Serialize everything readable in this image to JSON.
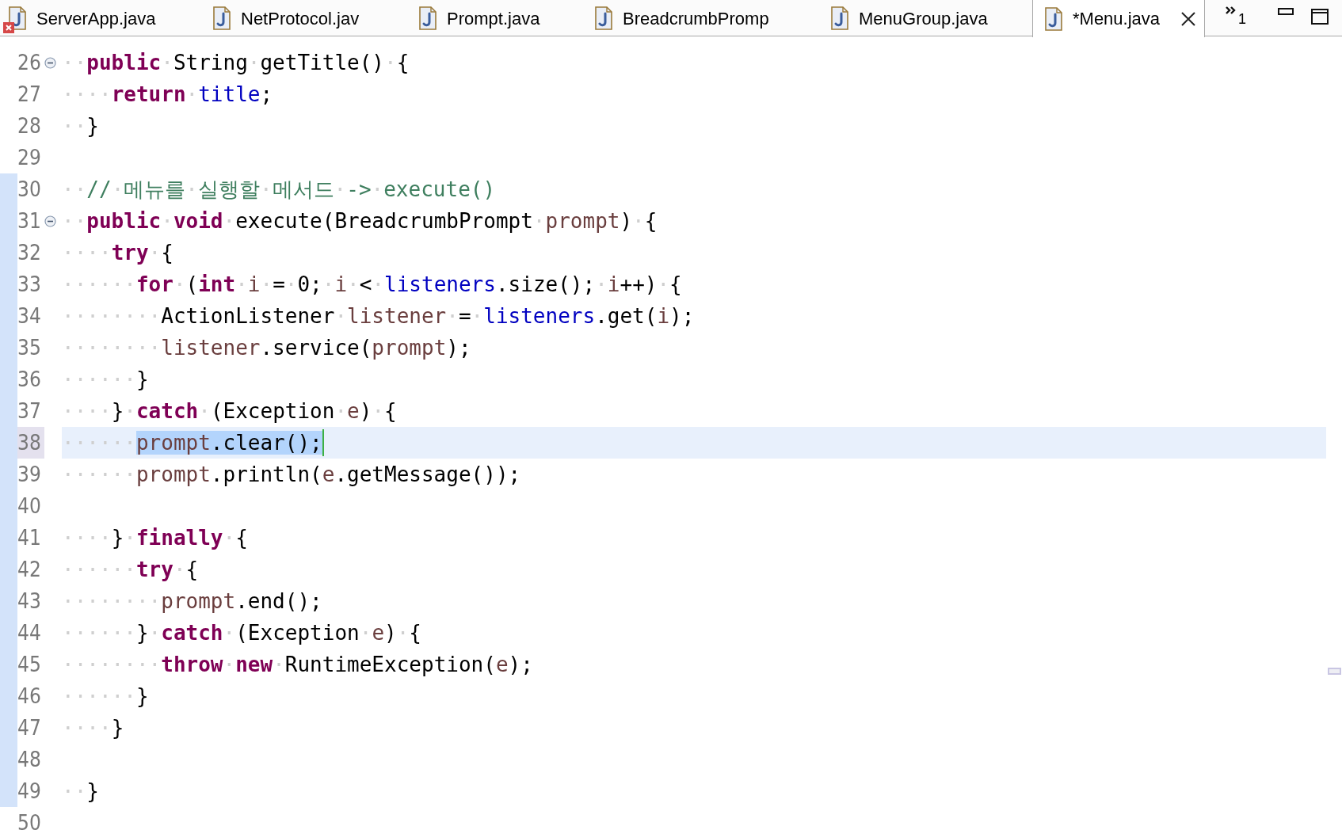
{
  "tabs": [
    {
      "label": "ServerApp.java",
      "selected": false,
      "has_error": true
    },
    {
      "label": "NetProtocol.jav",
      "selected": false,
      "has_error": false
    },
    {
      "label": "Prompt.java",
      "selected": false,
      "has_error": false
    },
    {
      "label": "BreadcrumbPromp",
      "selected": false,
      "has_error": false
    },
    {
      "label": "MenuGroup.java",
      "selected": false,
      "has_error": false
    },
    {
      "label": "*Menu.java",
      "selected": true,
      "has_error": false
    }
  ],
  "tab_overflow_count": "1",
  "lines": [
    {
      "number": "26",
      "fold": true,
      "current": false,
      "changed": false,
      "tokens": [
        {
          "kind": "ws",
          "text": "··"
        },
        {
          "kind": "kw",
          "text": "public"
        },
        {
          "kind": "ws",
          "text": "·"
        },
        {
          "kind": "plain",
          "text": "String"
        },
        {
          "kind": "ws",
          "text": "·"
        },
        {
          "kind": "plain",
          "text": "getTitle()"
        },
        {
          "kind": "ws",
          "text": "·"
        },
        {
          "kind": "plain",
          "text": "{"
        }
      ]
    },
    {
      "number": "27",
      "fold": false,
      "current": false,
      "changed": false,
      "tokens": [
        {
          "kind": "ws",
          "text": "····"
        },
        {
          "kind": "kw",
          "text": "return"
        },
        {
          "kind": "ws",
          "text": "·"
        },
        {
          "kind": "field",
          "text": "title"
        },
        {
          "kind": "plain",
          "text": ";"
        }
      ]
    },
    {
      "number": "28",
      "fold": false,
      "current": false,
      "changed": false,
      "tokens": [
        {
          "kind": "ws",
          "text": "··"
        },
        {
          "kind": "plain",
          "text": "}"
        }
      ]
    },
    {
      "number": "29",
      "fold": false,
      "current": false,
      "changed": false
    },
    {
      "number": "30",
      "fold": false,
      "current": false,
      "changed": true,
      "tokens": [
        {
          "kind": "ws",
          "text": "··"
        },
        {
          "kind": "comment",
          "text": "//"
        },
        {
          "kind": "ws",
          "text": "·"
        },
        {
          "kind": "comment",
          "text": "메뉴를"
        },
        {
          "kind": "ws",
          "text": "·"
        },
        {
          "kind": "comment",
          "text": "실행할"
        },
        {
          "kind": "ws",
          "text": "·"
        },
        {
          "kind": "comment",
          "text": "메서드"
        },
        {
          "kind": "ws",
          "text": "·"
        },
        {
          "kind": "comment",
          "text": "->"
        },
        {
          "kind": "ws",
          "text": "·"
        },
        {
          "kind": "comment",
          "text": "execute()"
        }
      ]
    },
    {
      "number": "31",
      "fold": true,
      "current": false,
      "changed": true,
      "tokens": [
        {
          "kind": "ws",
          "text": "··"
        },
        {
          "kind": "kw",
          "text": "public"
        },
        {
          "kind": "ws",
          "text": "·"
        },
        {
          "kind": "kw",
          "text": "void"
        },
        {
          "kind": "ws",
          "text": "·"
        },
        {
          "kind": "plain",
          "text": "execute(BreadcrumbPrompt"
        },
        {
          "kind": "ws",
          "text": "·"
        },
        {
          "kind": "local",
          "text": "prompt"
        },
        {
          "kind": "plain",
          "text": ")"
        },
        {
          "kind": "ws",
          "text": "·"
        },
        {
          "kind": "plain",
          "text": "{"
        }
      ]
    },
    {
      "number": "32",
      "fold": false,
      "current": false,
      "changed": true,
      "tokens": [
        {
          "kind": "ws",
          "text": "····"
        },
        {
          "kind": "kw",
          "text": "try"
        },
        {
          "kind": "ws",
          "text": "·"
        },
        {
          "kind": "plain",
          "text": "{"
        }
      ]
    },
    {
      "number": "33",
      "fold": false,
      "current": false,
      "changed": true,
      "tokens": [
        {
          "kind": "ws",
          "text": "······"
        },
        {
          "kind": "kw",
          "text": "for"
        },
        {
          "kind": "ws",
          "text": "·"
        },
        {
          "kind": "plain",
          "text": "("
        },
        {
          "kind": "kw",
          "text": "int"
        },
        {
          "kind": "ws",
          "text": "·"
        },
        {
          "kind": "local",
          "text": "i"
        },
        {
          "kind": "ws",
          "text": "·"
        },
        {
          "kind": "plain",
          "text": "="
        },
        {
          "kind": "ws",
          "text": "·"
        },
        {
          "kind": "plain",
          "text": "0;"
        },
        {
          "kind": "ws",
          "text": "·"
        },
        {
          "kind": "local",
          "text": "i"
        },
        {
          "kind": "ws",
          "text": "·"
        },
        {
          "kind": "plain",
          "text": "<"
        },
        {
          "kind": "ws",
          "text": "·"
        },
        {
          "kind": "field",
          "text": "listeners"
        },
        {
          "kind": "plain",
          "text": ".size();"
        },
        {
          "kind": "ws",
          "text": "·"
        },
        {
          "kind": "local",
          "text": "i"
        },
        {
          "kind": "plain",
          "text": "++)"
        },
        {
          "kind": "ws",
          "text": "·"
        },
        {
          "kind": "plain",
          "text": "{"
        }
      ]
    },
    {
      "number": "34",
      "fold": false,
      "current": false,
      "changed": true,
      "tokens": [
        {
          "kind": "ws",
          "text": "········"
        },
        {
          "kind": "plain",
          "text": "ActionListener"
        },
        {
          "kind": "ws",
          "text": "·"
        },
        {
          "kind": "local",
          "text": "listener"
        },
        {
          "kind": "ws",
          "text": "·"
        },
        {
          "kind": "plain",
          "text": "="
        },
        {
          "kind": "ws",
          "text": "·"
        },
        {
          "kind": "field",
          "text": "listeners"
        },
        {
          "kind": "plain",
          "text": ".get("
        },
        {
          "kind": "local",
          "text": "i"
        },
        {
          "kind": "plain",
          "text": ");"
        }
      ]
    },
    {
      "number": "35",
      "fold": false,
      "current": false,
      "changed": true,
      "tokens": [
        {
          "kind": "ws",
          "text": "········"
        },
        {
          "kind": "local",
          "text": "listener"
        },
        {
          "kind": "plain",
          "text": ".service("
        },
        {
          "kind": "local",
          "text": "prompt"
        },
        {
          "kind": "plain",
          "text": ");"
        }
      ]
    },
    {
      "number": "36",
      "fold": false,
      "current": false,
      "changed": true,
      "tokens": [
        {
          "kind": "ws",
          "text": "······"
        },
        {
          "kind": "plain",
          "text": "}"
        }
      ]
    },
    {
      "number": "37",
      "fold": false,
      "current": false,
      "changed": true,
      "tokens": [
        {
          "kind": "ws",
          "text": "····"
        },
        {
          "kind": "plain",
          "text": "}"
        },
        {
          "kind": "ws",
          "text": "·"
        },
        {
          "kind": "kw",
          "text": "catch"
        },
        {
          "kind": "ws",
          "text": "·"
        },
        {
          "kind": "plain",
          "text": "(Exception"
        },
        {
          "kind": "ws",
          "text": "·"
        },
        {
          "kind": "local",
          "text": "e"
        },
        {
          "kind": "plain",
          "text": ")"
        },
        {
          "kind": "ws",
          "text": "·"
        },
        {
          "kind": "plain",
          "text": "{"
        }
      ]
    },
    {
      "number": "38",
      "fold": false,
      "current": true,
      "changed": true,
      "tokens": [
        {
          "kind": "ws",
          "text": "······"
        },
        {
          "kind": "selection",
          "tokens": [
            {
              "kind": "local",
              "text": "prompt"
            },
            {
              "kind": "plain",
              "text": ".clear();"
            }
          ]
        }
      ]
    },
    {
      "number": "39",
      "fold": false,
      "current": false,
      "changed": true,
      "tokens": [
        {
          "kind": "ws",
          "text": "······"
        },
        {
          "kind": "local",
          "text": "prompt"
        },
        {
          "kind": "plain",
          "text": ".println("
        },
        {
          "kind": "local",
          "text": "e"
        },
        {
          "kind": "plain",
          "text": ".getMessage());"
        }
      ]
    },
    {
      "number": "40",
      "fold": false,
      "current": false,
      "changed": true
    },
    {
      "number": "41",
      "fold": false,
      "current": false,
      "changed": true,
      "tokens": [
        {
          "kind": "ws",
          "text": "····"
        },
        {
          "kind": "plain",
          "text": "}"
        },
        {
          "kind": "ws",
          "text": "·"
        },
        {
          "kind": "kw",
          "text": "finally"
        },
        {
          "kind": "ws",
          "text": "·"
        },
        {
          "kind": "plain",
          "text": "{"
        }
      ]
    },
    {
      "number": "42",
      "fold": false,
      "current": false,
      "changed": true,
      "tokens": [
        {
          "kind": "ws",
          "text": "······"
        },
        {
          "kind": "kw",
          "text": "try"
        },
        {
          "kind": "ws",
          "text": "·"
        },
        {
          "kind": "plain",
          "text": "{"
        }
      ]
    },
    {
      "number": "43",
      "fold": false,
      "current": false,
      "changed": true,
      "tokens": [
        {
          "kind": "ws",
          "text": "········"
        },
        {
          "kind": "local",
          "text": "prompt"
        },
        {
          "kind": "plain",
          "text": ".end();"
        }
      ]
    },
    {
      "number": "44",
      "fold": false,
      "current": false,
      "changed": true,
      "tokens": [
        {
          "kind": "ws",
          "text": "······"
        },
        {
          "kind": "plain",
          "text": "}"
        },
        {
          "kind": "ws",
          "text": "·"
        },
        {
          "kind": "kw",
          "text": "catch"
        },
        {
          "kind": "ws",
          "text": "·"
        },
        {
          "kind": "plain",
          "text": "(Exception"
        },
        {
          "kind": "ws",
          "text": "·"
        },
        {
          "kind": "local",
          "text": "e"
        },
        {
          "kind": "plain",
          "text": ")"
        },
        {
          "kind": "ws",
          "text": "·"
        },
        {
          "kind": "plain",
          "text": "{"
        }
      ]
    },
    {
      "number": "45",
      "fold": false,
      "current": false,
      "changed": true,
      "tokens": [
        {
          "kind": "ws",
          "text": "········"
        },
        {
          "kind": "kw",
          "text": "throw"
        },
        {
          "kind": "ws",
          "text": "·"
        },
        {
          "kind": "kw",
          "text": "new"
        },
        {
          "kind": "ws",
          "text": "·"
        },
        {
          "kind": "plain",
          "text": "RuntimeException("
        },
        {
          "kind": "local",
          "text": "e"
        },
        {
          "kind": "plain",
          "text": ");"
        }
      ]
    },
    {
      "number": "46",
      "fold": false,
      "current": false,
      "changed": true,
      "tokens": [
        {
          "kind": "ws",
          "text": "······"
        },
        {
          "kind": "plain",
          "text": "}"
        }
      ]
    },
    {
      "number": "47",
      "fold": false,
      "current": false,
      "changed": true,
      "tokens": [
        {
          "kind": "ws",
          "text": "····"
        },
        {
          "kind": "plain",
          "text": "}"
        }
      ]
    },
    {
      "number": "48",
      "fold": false,
      "current": false,
      "changed": true
    },
    {
      "number": "49",
      "fold": false,
      "current": false,
      "changed": true,
      "tokens": [
        {
          "kind": "ws",
          "text": "··"
        },
        {
          "kind": "plain",
          "text": "}"
        }
      ]
    },
    {
      "number": "50",
      "fold": false,
      "current": false,
      "changed": false
    }
  ]
}
